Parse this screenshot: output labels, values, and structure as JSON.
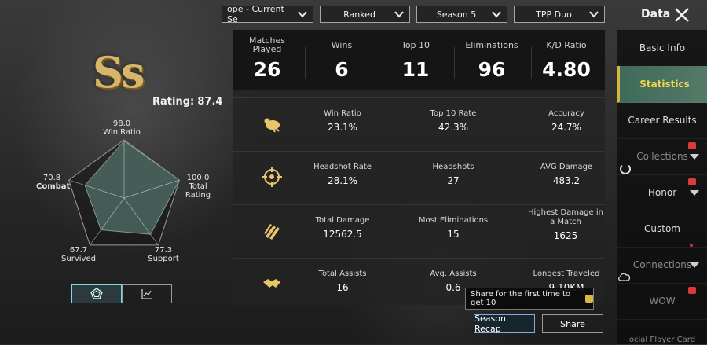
{
  "header": {
    "title": "Data",
    "filters": [
      {
        "value": "ope - Current Se"
      },
      {
        "value": "Ranked"
      },
      {
        "value": "Season 5"
      },
      {
        "value": "TPP Duo"
      }
    ]
  },
  "profile": {
    "tier": "Ss",
    "rating_label": "Rating:",
    "rating_value": "87.4"
  },
  "radar": {
    "axes": [
      {
        "name": "Win Ratio",
        "value": 98.0,
        "value_text": "98.0"
      },
      {
        "name": "Total Rating",
        "value": 100.0,
        "value_text": "100.0"
      },
      {
        "name": "Support",
        "value": 77.3,
        "value_text": "77.3"
      },
      {
        "name": "Survived",
        "value": 67.7,
        "value_text": "67.7"
      },
      {
        "name": "Combat",
        "value": 70.8,
        "value_text": "70.8"
      }
    ],
    "max": 100,
    "fill_color": "#4f6a64"
  },
  "summary": [
    {
      "label": "Matches\nPlayed",
      "value": "26"
    },
    {
      "label": "Wins",
      "value": "6"
    },
    {
      "label": "Top 10",
      "value": "11"
    },
    {
      "label": "Eliminations",
      "value": "96"
    },
    {
      "label": "K/D Ratio",
      "value": "4.80"
    }
  ],
  "rows": [
    {
      "icon": "chicken-icon",
      "cells": [
        {
          "label": "Win Ratio",
          "value": "23.1%"
        },
        {
          "label": "Top 10 Rate",
          "value": "42.3%"
        },
        {
          "label": "Accuracy",
          "value": "24.7%"
        }
      ]
    },
    {
      "icon": "crosshair-icon",
      "cells": [
        {
          "label": "Headshot Rate",
          "value": "28.1%"
        },
        {
          "label": "Headshots",
          "value": "27"
        },
        {
          "label": "AVG Damage",
          "value": "483.2"
        }
      ]
    },
    {
      "icon": "bullets-icon",
      "cells": [
        {
          "label": "Total Damage",
          "value": "12562.5"
        },
        {
          "label": "Most Eliminations",
          "value": "15"
        },
        {
          "label": "Highest Damage in a Match",
          "value": "1625"
        }
      ]
    },
    {
      "icon": "handshake-icon",
      "cells": [
        {
          "label": "Total Assists",
          "value": "16"
        },
        {
          "label": "Avg. Assists",
          "value": "0.6"
        },
        {
          "label": "Longest Traveled",
          "value": "9.10KM"
        }
      ]
    }
  ],
  "sidebar": {
    "items": [
      {
        "label": "Basic Info"
      },
      {
        "label": "Statistics"
      },
      {
        "label": "Career Results"
      },
      {
        "label": "Collections"
      },
      {
        "label": "Honor"
      },
      {
        "label": "Custom"
      },
      {
        "label": "Connections"
      },
      {
        "label": "WOW"
      },
      {
        "label": "ocial Player Card"
      }
    ],
    "active_index": 1
  },
  "share": {
    "tooltip": "Share for the first time to get 10",
    "recap_label": "Season Recap",
    "share_label": "Share"
  },
  "colors": {
    "accent": "#d8b640",
    "tier_gold": "#d6b66a",
    "active_text": "#f4d64a"
  }
}
